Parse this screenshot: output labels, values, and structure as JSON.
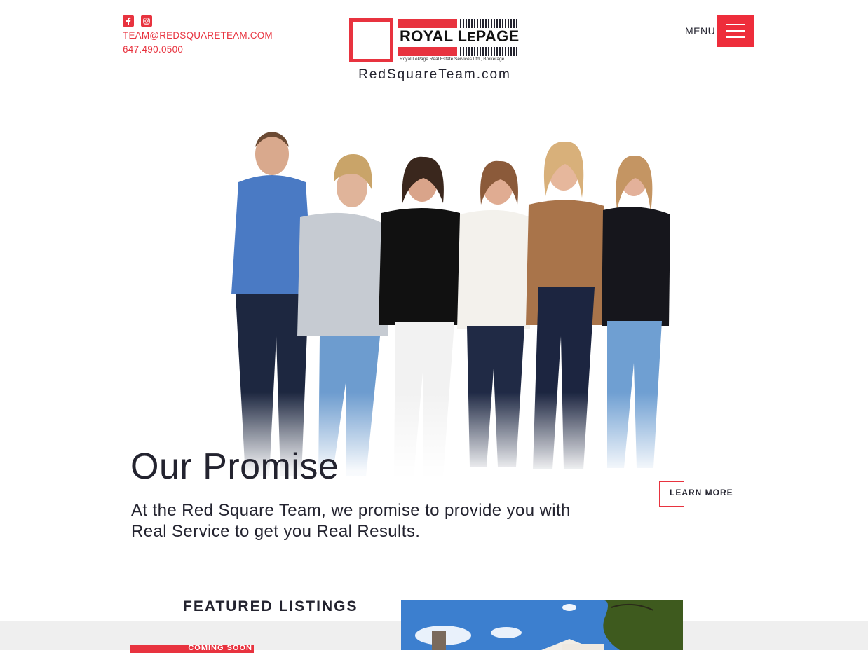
{
  "header": {
    "social": [
      {
        "name": "facebook-icon"
      },
      {
        "name": "instagram-icon"
      }
    ],
    "email": "TEAM@REDSQUARETEAM.COM",
    "phone": "647.490.0500",
    "logo": {
      "brand_main": "ROYAL L",
      "brand_e": "E",
      "brand_page": "PAGE",
      "subline": "Royal LePage Real Estate Services Ltd., Brokerage",
      "site": "RedSquareTeam.com"
    },
    "menu_label": "MENU"
  },
  "hero": {
    "title": "Our Promise",
    "text": "At the Red Square Team, we promise to provide you with Real Service to get you Real Results.",
    "learn_more": "LEARN MORE"
  },
  "featured": {
    "heading": "FEATURED LISTINGS",
    "badge": "COMING SOON"
  },
  "colors": {
    "accent": "#e8333f",
    "text": "#23232f",
    "band": "#efefef"
  }
}
